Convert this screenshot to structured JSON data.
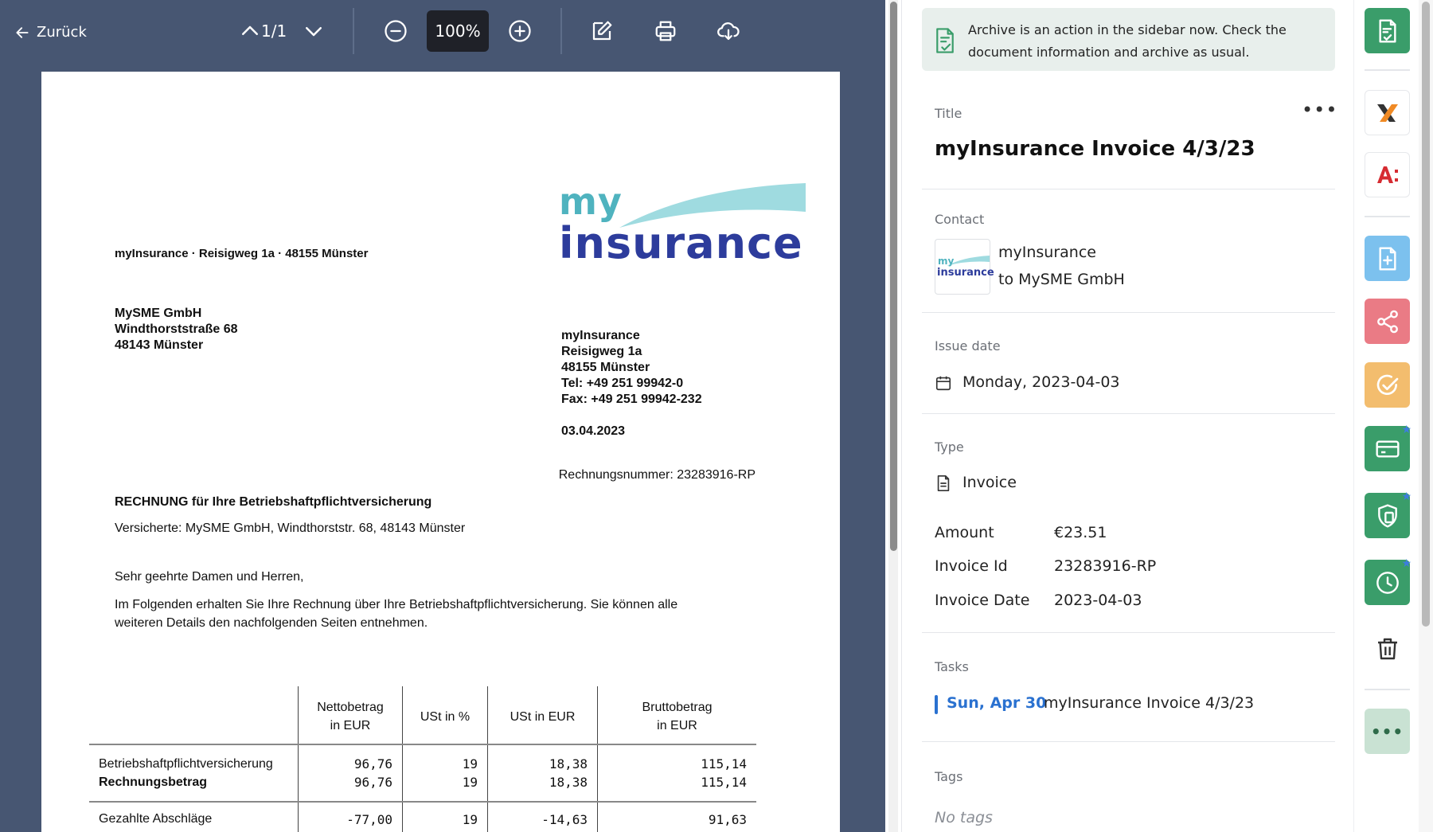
{
  "toolbar": {
    "back_label": "Zurück",
    "page_indicator": "1/1",
    "zoom": "100%"
  },
  "document": {
    "sender_line": "myInsurance · Reisigweg 1a · 48155 Münster",
    "logo_my": "my",
    "logo_insurance": "insurance",
    "recipient": [
      "MySME GmbH",
      "Windthorststraße 68",
      "48143 Münster"
    ],
    "from": [
      "myInsurance",
      "Reisigweg 1a",
      "48155 Münster",
      "Tel:  +49 251 99942-0",
      "Fax: +49 251 99942-232"
    ],
    "date": "03.04.2023",
    "invoice_number": "Rechnungsnummer: 23283916-RP",
    "subject": "RECHNUNG für Ihre Betriebshaftpflichtversicherung",
    "insured": "Versicherte: MySME GmbH, Windthorststr. 68, 48143 Münster",
    "salutation": "Sehr geehrte Damen und Herren,",
    "body": "Im Folgenden erhalten Sie Ihre Rechnung über Ihre Betriebshaftpflichtversicherung. Sie können alle weiteren Details den nachfolgenden Seiten entnehmen.",
    "table": {
      "headers": [
        "",
        "Nettobetrag\nin EUR",
        "USt in %",
        "USt in EUR",
        "Bruttobetrag\nin EUR"
      ],
      "header_lines": [
        [
          ""
        ],
        [
          "Nettobetrag",
          "in EUR"
        ],
        [
          "USt in %"
        ],
        [
          "USt in EUR"
        ],
        [
          "Bruttobetrag",
          "in EUR"
        ]
      ],
      "rows": [
        {
          "label": "Betriebshaftpflichtversicherung",
          "net": "96,76",
          "vat_pct": "19",
          "vat": "18,38",
          "gross": "115,14"
        },
        {
          "label": "Rechnungsbetrag",
          "net": "96,76",
          "vat_pct": "19",
          "vat": "18,38",
          "gross": "115,14"
        },
        {
          "label": "Gezahlte Abschläge",
          "net": "-77,00",
          "vat_pct": "19",
          "vat": "-14,63",
          "gross": "91,63"
        }
      ]
    }
  },
  "sidebar": {
    "notice": "Archive is an action in the sidebar now. Check the document information and archive as usual.",
    "title_label": "Title",
    "title": "myInsurance Invoice 4/3/23",
    "more_label": "•••",
    "contact_label": "Contact",
    "contact_name": "myInsurance",
    "contact_sub": "to MySME GmbH",
    "contact_logo_my": "my",
    "contact_logo_insurance": "insurance",
    "issue_date_label": "Issue date",
    "issue_date": "Monday, 2023-04-03",
    "type_label": "Type",
    "type": "Invoice",
    "fields": [
      {
        "key": "Amount",
        "value": "€23.51"
      },
      {
        "key": "Invoice Id",
        "value": "23283916-RP"
      },
      {
        "key": "Invoice Date",
        "value": "2023-04-03"
      }
    ],
    "tasks_label": "Tasks",
    "task_date": "Sun, Apr 30",
    "task_name": "myInsurance Invoice 4/3/23",
    "tags_label": "Tags",
    "no_tags": "No tags"
  },
  "rail": {
    "actions": [
      {
        "name": "archive-document-icon",
        "color": "#3a9d6a"
      },
      {
        "name": "xero-icon",
        "color": "#ffffff"
      },
      {
        "name": "a-colon-icon",
        "color": "#ffffff"
      },
      {
        "name": "add-document-icon",
        "color": "#7cc1ee"
      },
      {
        "name": "share-icon",
        "color": "#ea7b85"
      },
      {
        "name": "check-circle-icon",
        "color": "#f3bd6e"
      },
      {
        "name": "credit-card-icon",
        "color": "#3a9d6a"
      },
      {
        "name": "shield-document-icon",
        "color": "#3a9d6a"
      },
      {
        "name": "clock-icon",
        "color": "#3a9d6a"
      },
      {
        "name": "trash-icon",
        "color": "#ffffff"
      },
      {
        "name": "more-icon",
        "color": "#c9e2d3"
      }
    ],
    "more_label": "•••"
  },
  "colors": {
    "viewer_bg": "#475672",
    "accent_blue": "#2a71d0",
    "brand_teal": "#4fb3bf",
    "brand_navy": "#2d3c9c"
  }
}
